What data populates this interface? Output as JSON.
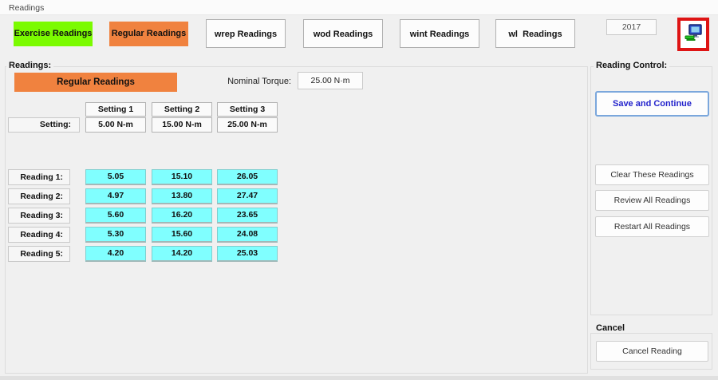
{
  "window": {
    "title": "Readings"
  },
  "top_bar": {
    "tabs": [
      {
        "label": "Exercise Readings",
        "style": "green"
      },
      {
        "label": "Regular Readings",
        "style": "orange"
      },
      {
        "label": "wrep Readings",
        "style": "plain"
      },
      {
        "label": "wod Readings",
        "style": "plain"
      },
      {
        "label": "wint Readings",
        "style": "plain"
      },
      {
        "label": "wl  Readings",
        "style": "plain"
      }
    ],
    "year_value": "2017",
    "icon": "my-computer-icon"
  },
  "readings_panel": {
    "group_label": "Readings:",
    "mode_banner": "Regular Readings",
    "nominal_torque_label": "Nominal Torque:",
    "nominal_torque_value": "25.00 N·m",
    "table": {
      "column_headers": [
        "Setting 1",
        "Setting 2",
        "Setting 3"
      ],
      "setting_row_label": "Setting:",
      "setting_values": [
        "5.00 N-m",
        "15.00 N-m",
        "25.00 N-m"
      ],
      "reading_rows": [
        {
          "label": "Reading 1:",
          "values": [
            "5.05",
            "15.10",
            "26.05"
          ]
        },
        {
          "label": "Reading 2:",
          "values": [
            "4.97",
            "13.80",
            "27.47"
          ]
        },
        {
          "label": "Reading 3:",
          "values": [
            "5.60",
            "16.20",
            "23.65"
          ]
        },
        {
          "label": "Reading 4:",
          "values": [
            "5.30",
            "15.60",
            "24.08"
          ]
        },
        {
          "label": "Reading 5:",
          "values": [
            "4.20",
            "14.20",
            "25.03"
          ]
        }
      ]
    }
  },
  "control_panel": {
    "group_label": "Reading Control:",
    "save_button_label": "Save and Continue",
    "clear_button_label": "Clear These Readings",
    "review_button_label": "Review All Readings",
    "restart_button_label": "Restart All Readings",
    "cancel_section_label": "Cancel",
    "cancel_button_label": "Cancel Reading"
  },
  "colors": {
    "green-tab": "#7BFB00",
    "orange-tab": "#F0823F",
    "reading-cell": "#80FFFF",
    "save-border": "#7BA7DC",
    "save-text": "#2323CC",
    "icon-frame-red": "#DE1414",
    "window-bg": "#F0F0F0"
  }
}
